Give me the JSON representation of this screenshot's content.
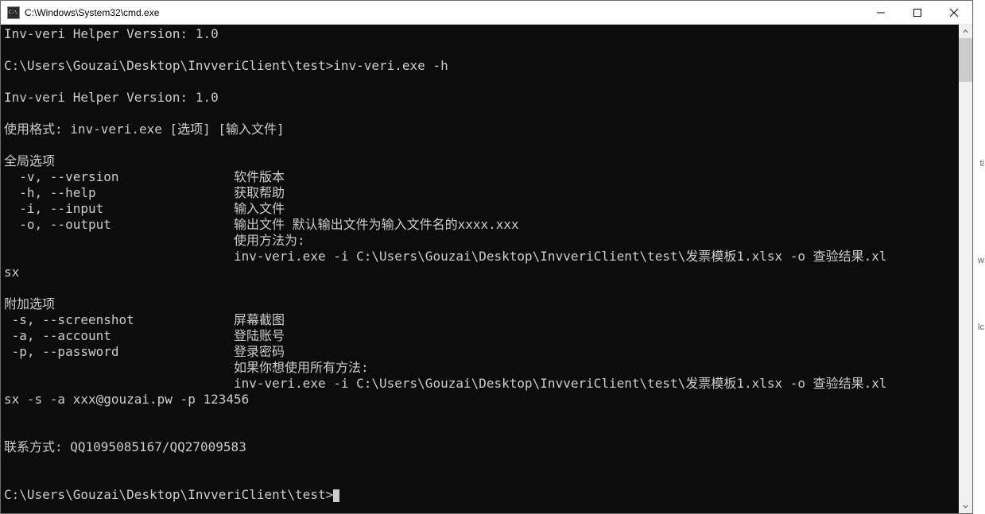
{
  "window": {
    "title": "C:\\Windows\\System32\\cmd.exe"
  },
  "terminal": {
    "lines": [
      "Inv-veri Helper Version: 1.0",
      "",
      "C:\\Users\\Gouzai\\Desktop\\InvveriClient\\test>inv-veri.exe -h",
      "",
      "Inv-veri Helper Version: 1.0",
      "",
      "使用格式: inv-veri.exe [选项] [输入文件]",
      "",
      "全局选项",
      "  -v, --version               软件版本",
      "  -h, --help                  获取帮助",
      "  -i, --input                 输入文件",
      "  -o, --output                输出文件 默认输出文件为输入文件名的xxxx.xxx",
      "                              使用方法为:",
      "                              inv-veri.exe -i C:\\Users\\Gouzai\\Desktop\\InvveriClient\\test\\发票模板1.xlsx -o 查验结果.xl",
      "sx",
      "",
      "附加选项",
      " -s, --screenshot             屏幕截图",
      " -a, --account                登陆账号",
      " -p, --password               登录密码",
      "                              如果你想使用所有方法:",
      "                              inv-veri.exe -i C:\\Users\\Gouzai\\Desktop\\InvveriClient\\test\\发票模板1.xlsx -o 查验结果.xl",
      "sx -s -a xxx@gouzai.pw -p 123456",
      "",
      "",
      "联系方式: QQ1095085167/QQ27009583",
      "",
      ""
    ],
    "prompt": "C:\\Users\\Gouzai\\Desktop\\InvveriClient\\test>"
  },
  "edge_hints": {
    "t1": "ti",
    "t2": "w",
    "t3": "lc"
  }
}
